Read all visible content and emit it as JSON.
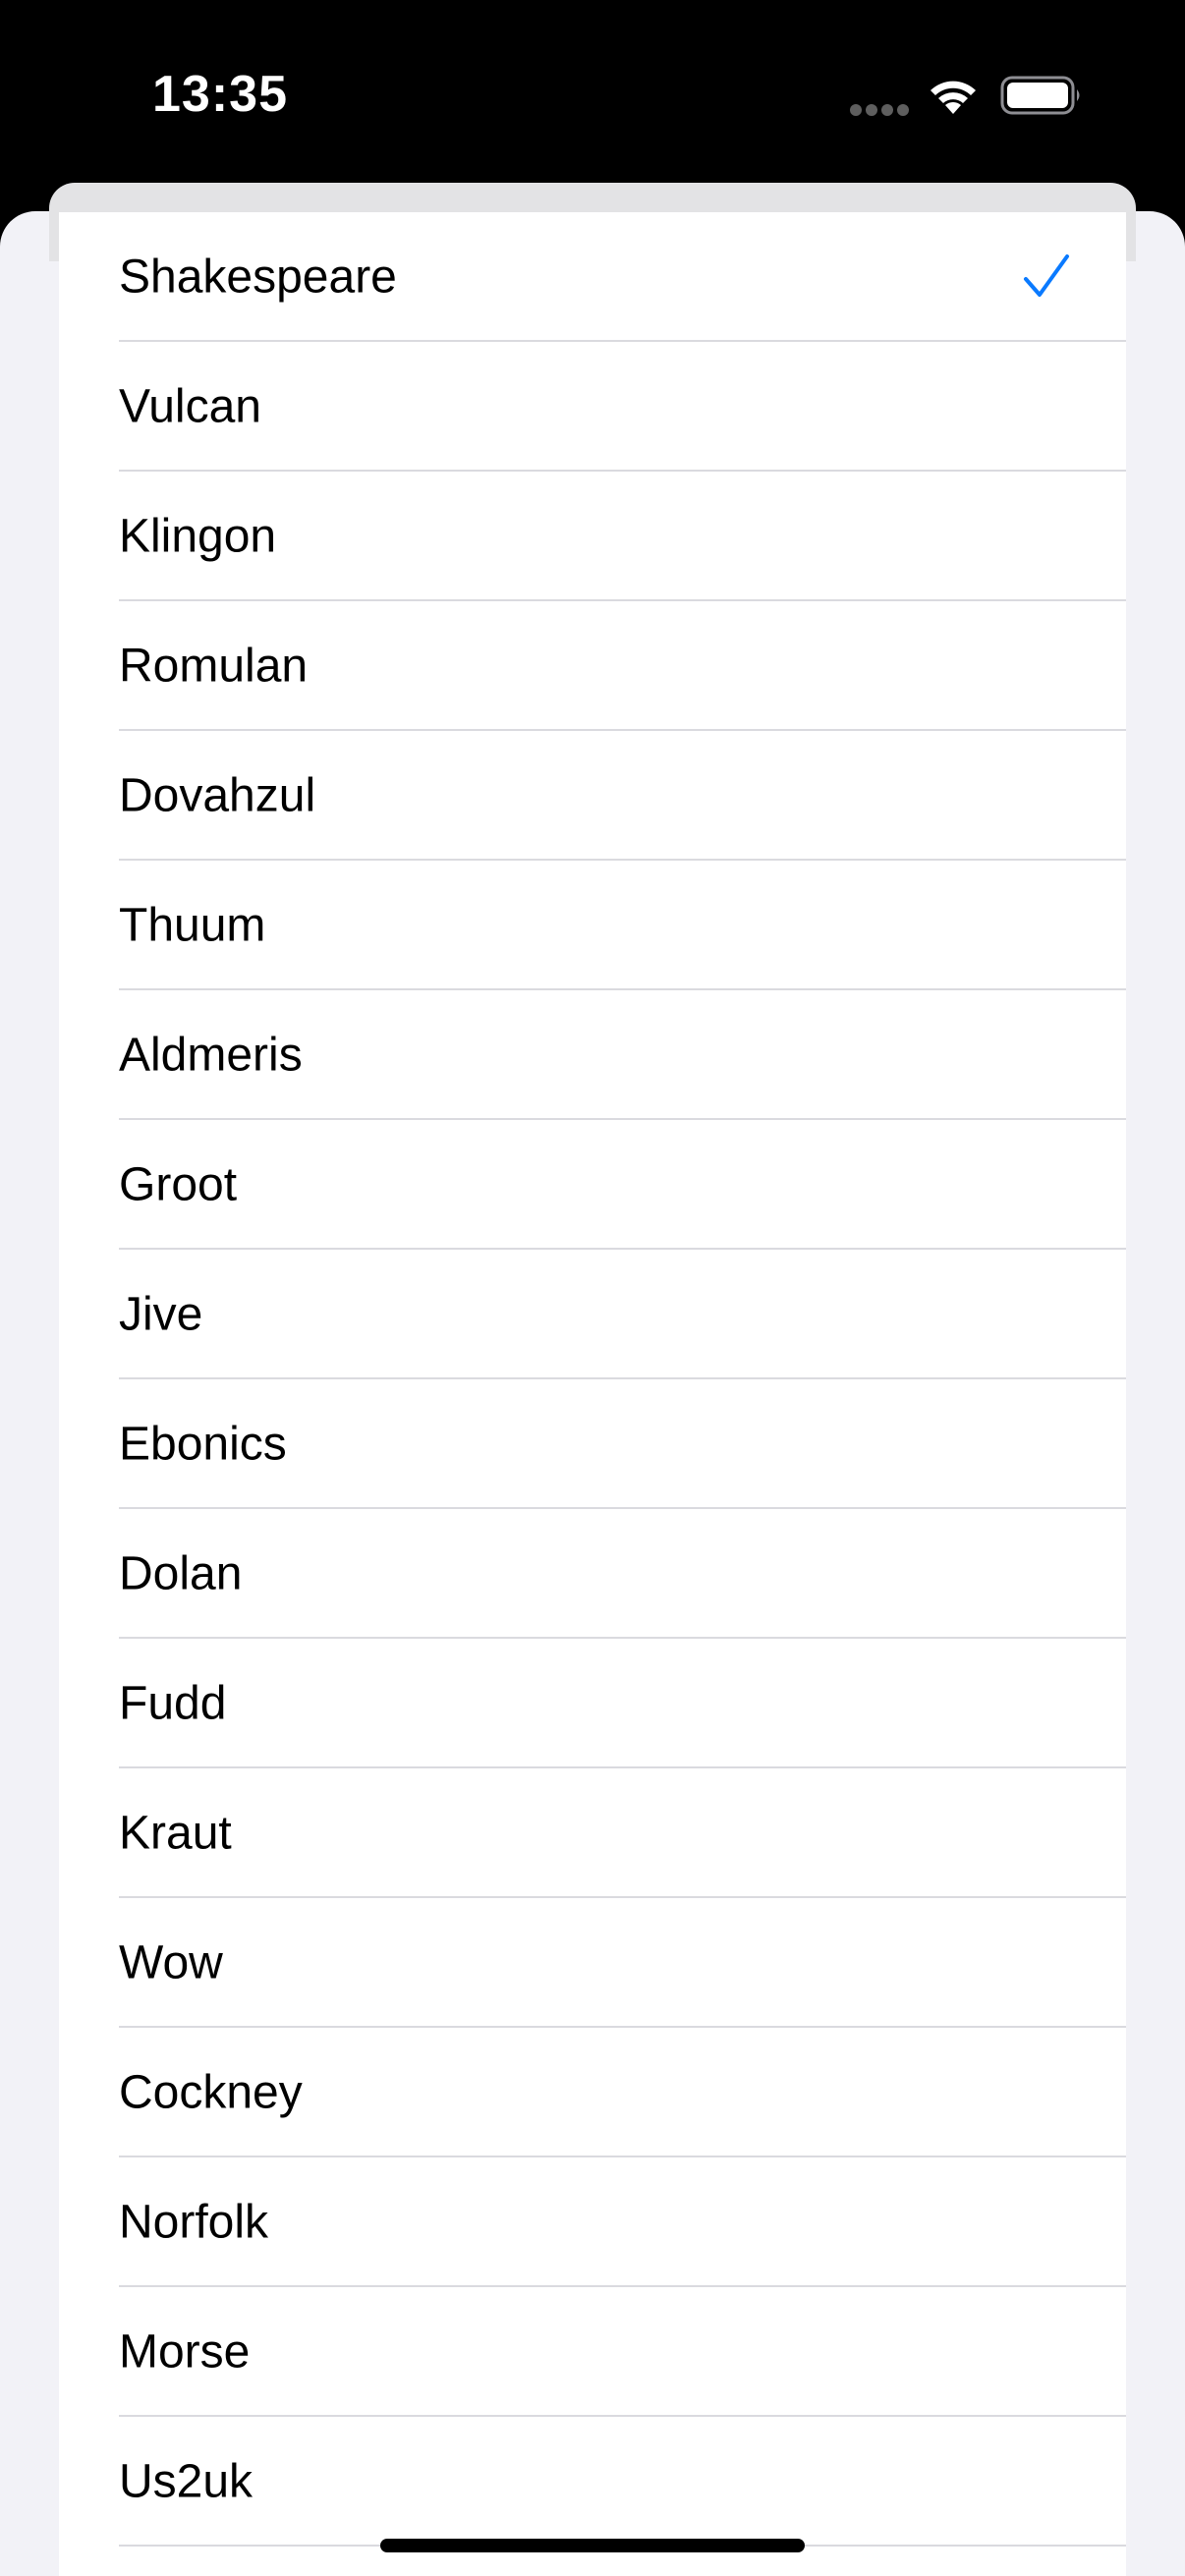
{
  "status_bar": {
    "time": "13:35",
    "icons": [
      "cellular-signal-icon",
      "wifi-icon",
      "battery-icon"
    ]
  },
  "list": {
    "items": [
      {
        "label": "Shakespeare",
        "selected": true
      },
      {
        "label": "Vulcan",
        "selected": false
      },
      {
        "label": "Klingon",
        "selected": false
      },
      {
        "label": "Romulan",
        "selected": false
      },
      {
        "label": "Dovahzul",
        "selected": false
      },
      {
        "label": "Thuum",
        "selected": false
      },
      {
        "label": "Aldmeris",
        "selected": false
      },
      {
        "label": "Groot",
        "selected": false
      },
      {
        "label": "Jive",
        "selected": false
      },
      {
        "label": "Ebonics",
        "selected": false
      },
      {
        "label": "Dolan",
        "selected": false
      },
      {
        "label": "Fudd",
        "selected": false
      },
      {
        "label": "Kraut",
        "selected": false
      },
      {
        "label": "Wow",
        "selected": false
      },
      {
        "label": "Cockney",
        "selected": false
      },
      {
        "label": "Norfolk",
        "selected": false
      },
      {
        "label": "Morse",
        "selected": false
      },
      {
        "label": "Us2uk",
        "selected": false
      }
    ]
  },
  "colors": {
    "accent": "#0a7aff",
    "background": "#f2f2f7",
    "separator": "#dadadf"
  }
}
